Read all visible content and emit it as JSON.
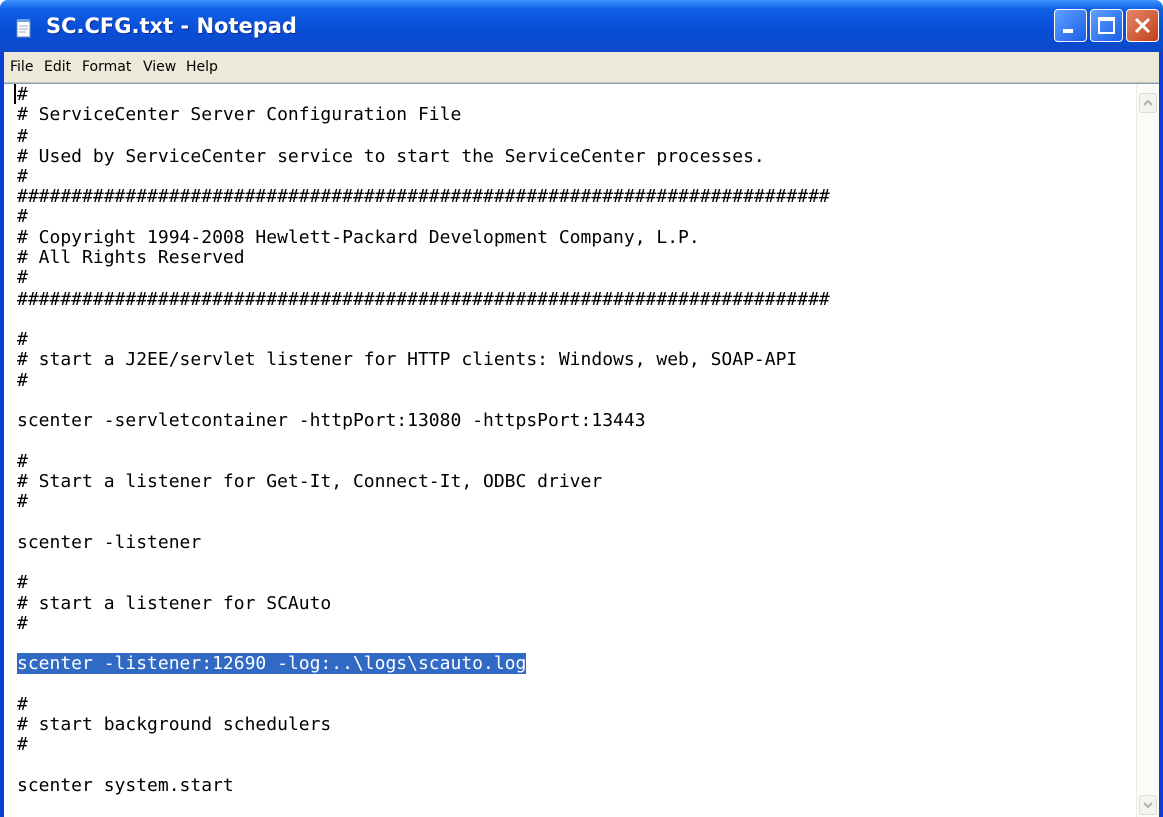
{
  "window": {
    "title": "SC.CFG.txt - Notepad",
    "icon": "notepad-icon",
    "caption_buttons": [
      "minimize-icon",
      "maximize-icon",
      "close-icon"
    ]
  },
  "menu": {
    "file": "File",
    "edit": "Edit",
    "format": "Format",
    "view": "View",
    "help": "Help"
  },
  "document": {
    "lines": [
      "#",
      "# ServiceCenter Server Configuration File",
      "#",
      "# Used by ServiceCenter service to start the ServiceCenter processes.",
      "#",
      "###########################################################################",
      "#",
      "# Copyright 1994-2008 Hewlett-Packard Development Company, L.P.",
      "# All Rights Reserved",
      "#",
      "###########################################################################",
      "",
      "#",
      "# start a J2EE/servlet listener for HTTP clients: Windows, web, SOAP-API",
      "#",
      "",
      "scenter -servletcontainer -httpPort:13080 -httpsPort:13443",
      "",
      "#",
      "# Start a listener for Get-It, Connect-It, ODBC driver",
      "#",
      "",
      "scenter -listener",
      "",
      "#",
      "# start a listener for SCAuto",
      "#",
      "",
      "scenter -listener:12690 -log:..\\logs\\scauto.log",
      "",
      "#",
      "# start background schedulers",
      "#",
      "",
      "scenter system.start"
    ],
    "selected_line": "scenter -listener:12690 -log:..\\logs\\scauto.log"
  },
  "colors": {
    "titlebar": "#0a4fd8",
    "selection": "#316ac5",
    "menubar": "#ece9d8"
  }
}
